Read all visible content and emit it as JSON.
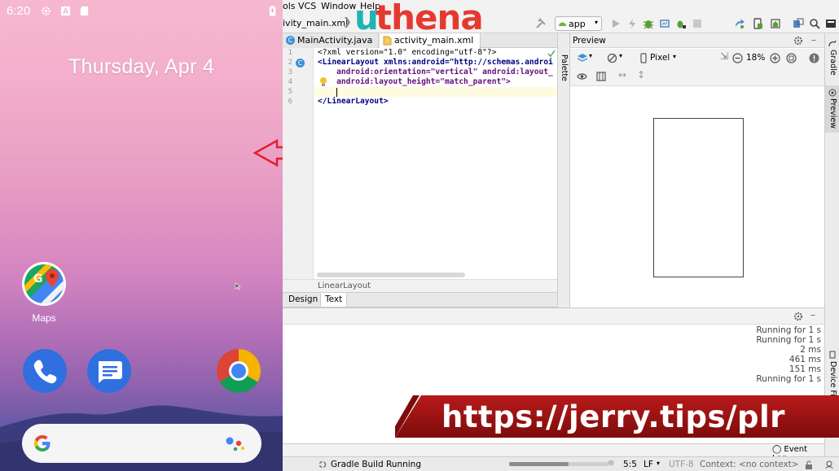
{
  "phone": {
    "status_time": "6:20",
    "status_icons": [
      "gear-icon",
      "a-icon",
      "sd-card-icon",
      "battery-icon"
    ],
    "date": "Thursday, Apr 4",
    "apps": [
      {
        "label": "Maps",
        "icon": "google-maps-icon"
      }
    ],
    "dock": [
      "phone-icon",
      "messages-icon",
      "chrome-icon"
    ],
    "search_icons": [
      "google-g-icon",
      "assistant-icon"
    ]
  },
  "studio": {
    "menu": [
      "ols",
      "VCS",
      "Window",
      "Help"
    ],
    "breadcrumb": "ivity_main.xml",
    "logo": "uthena",
    "run_config": "app",
    "tabs": [
      {
        "label": "MainActivity.java",
        "icon": "class-icon"
      },
      {
        "label": "activity_main.xml",
        "icon": "xml-icon",
        "active": true
      }
    ],
    "code_lines": [
      {
        "n": "1",
        "text": "<?xml version=\"1.0\" encoding=\"utf-8\"?>"
      },
      {
        "n": "2",
        "text": "<LinearLayout xmlns:android=\"http://schemas.androi"
      },
      {
        "n": "3",
        "text": "    android:orientation=\"vertical\" android:layout_"
      },
      {
        "n": "4",
        "text": "    android:layout_height=\"match_parent\">"
      },
      {
        "n": "5",
        "text": "    "
      },
      {
        "n": "6",
        "text": "</LinearLayout>"
      }
    ],
    "editor_breadcrumb": "LinearLayout",
    "design_tabs": [
      "Design",
      "Text"
    ],
    "palette_label": "Palette",
    "preview_title": "Preview",
    "device": "Pixel",
    "zoom": "18%",
    "side_labels": [
      "Gradle",
      "Preview",
      "Device Fi"
    ],
    "build_log": [
      "Running for 1 s",
      "Running for 1 s",
      "2 ms",
      "461 ms",
      "151 ms",
      "Running for 1 s"
    ],
    "banner_url": "https://jerry.tips/plr",
    "event_log": "Event Log",
    "status": {
      "build": "Gradle Build Running",
      "position": "5:5",
      "line_sep": "LF",
      "encoding": "UTF-8",
      "context": "Context: <no context>"
    }
  },
  "colors": {
    "banner_red": "#9b1111",
    "logo_teal": "#1fb3b3",
    "logo_red": "#e5392f"
  }
}
